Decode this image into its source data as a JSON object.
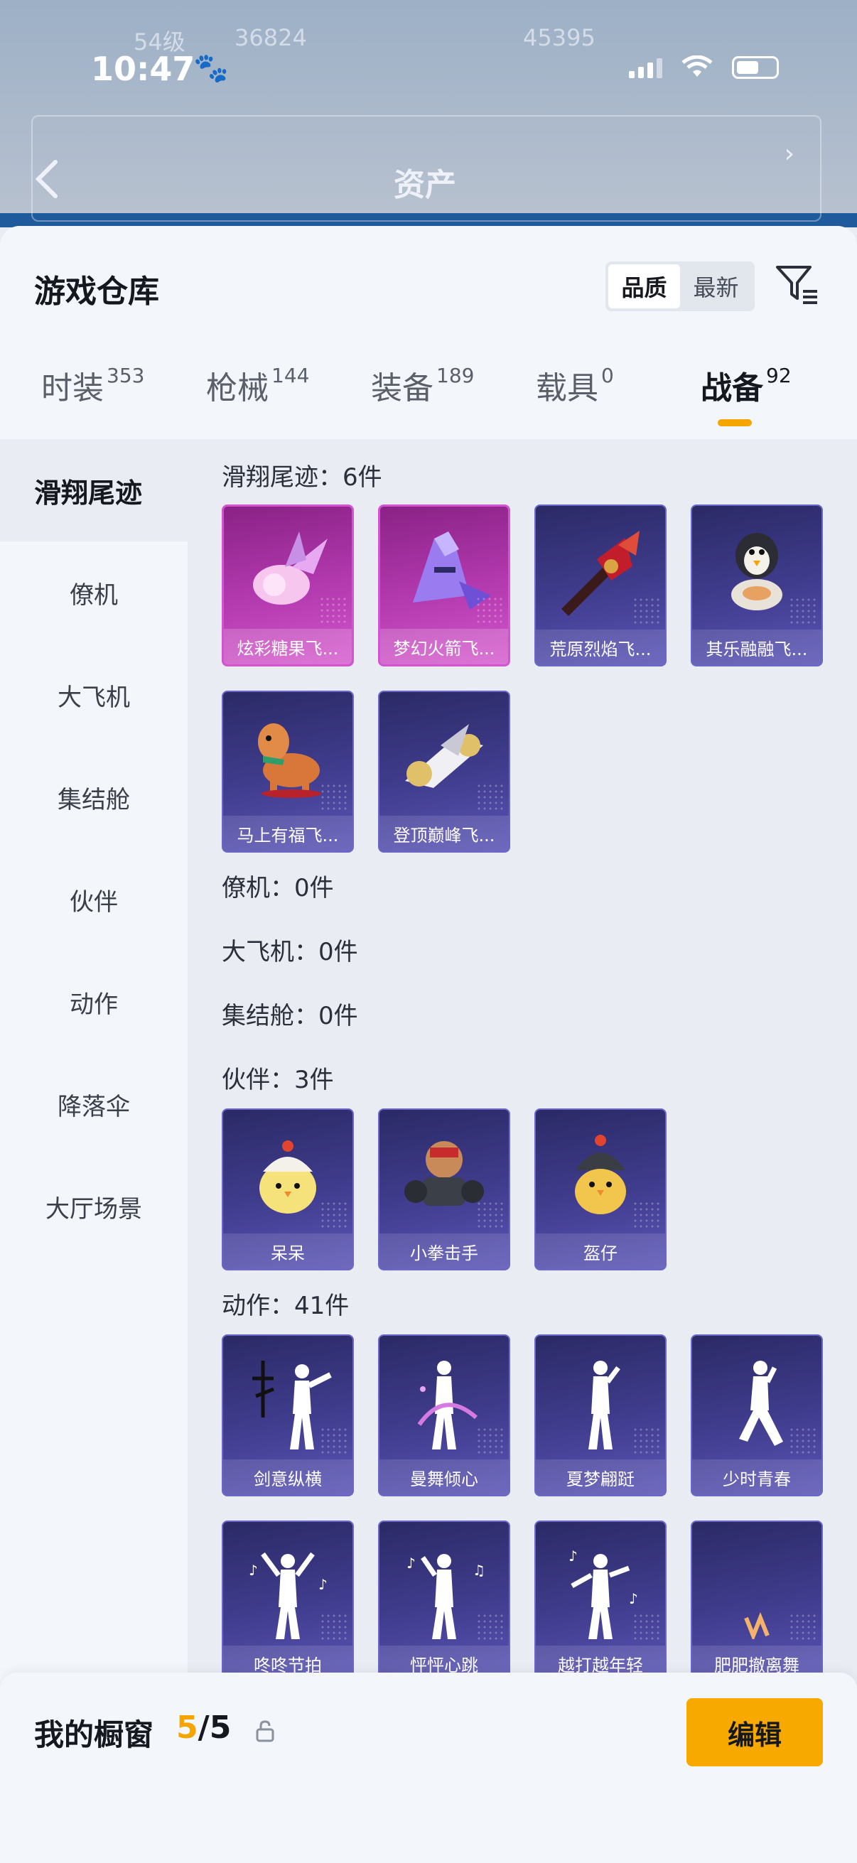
{
  "status_bar": {
    "time": "10:47",
    "paw": "🐾"
  },
  "backdrop": {
    "title": "资产",
    "ghost_level": "54级",
    "ghost_num1": "36824",
    "ghost_num2": "45395"
  },
  "header": {
    "title": "游戏仓库",
    "sort": [
      "品质",
      "最新"
    ],
    "sort_active": 0
  },
  "tabs": [
    {
      "label": "时装",
      "count": "353"
    },
    {
      "label": "枪械",
      "count": "144"
    },
    {
      "label": "装备",
      "count": "189"
    },
    {
      "label": "载具",
      "count": "0"
    },
    {
      "label": "战备",
      "count": "92"
    }
  ],
  "active_tab": 4,
  "sidebar": [
    "滑翔尾迹",
    "僚机",
    "大飞机",
    "集结舱",
    "伙伴",
    "动作",
    "降落伞",
    "大厅场景"
  ],
  "sections": {
    "glide": {
      "title": "滑翔尾迹：6件",
      "items": [
        "炫彩糖果飞...",
        "梦幻火箭飞...",
        "荒原烈焰飞...",
        "其乐融融飞...",
        "马上有福飞...",
        "登顶巅峰飞..."
      ]
    },
    "wingman": {
      "title": "僚机：0件"
    },
    "bigplane": {
      "title": "大飞机：0件"
    },
    "pod": {
      "title": "集结舱：0件"
    },
    "partner": {
      "title": "伙伴：3件",
      "items": [
        "呆呆",
        "小拳击手",
        "盔仔"
      ]
    },
    "emote": {
      "title": "动作：41件",
      "items": [
        "剑意纵横",
        "曼舞倾心",
        "夏梦翩跹",
        "少时青春",
        "咚咚节拍",
        "怦怦心跳",
        "越打越年轻",
        "肥肥撤离舞"
      ]
    }
  },
  "bottom": {
    "label": "我的橱窗",
    "current": "5",
    "sep": "/",
    "total": "5",
    "edit": "编辑"
  },
  "colors": {
    "accent": "#f5a500",
    "card_blue": "#413d8f",
    "card_pink": "#b43ab0"
  }
}
